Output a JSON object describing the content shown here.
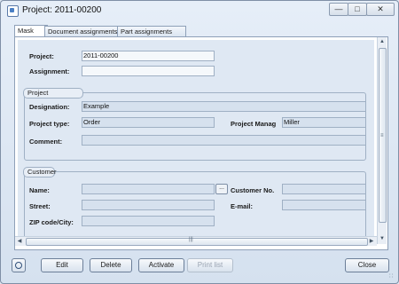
{
  "window": {
    "title": "Project: 2011-00200"
  },
  "tabs": [
    "Mask",
    "Document assignments",
    "Part assignments"
  ],
  "top": {
    "project_label": "Project:",
    "project_value": "2011-00200",
    "assignment_label": "Assignment:",
    "assignment_value": ""
  },
  "project_group": {
    "title": "Project",
    "designation_label": "Designation:",
    "designation_value": "Example",
    "type_label": "Project type:",
    "type_value": "Order",
    "manager_label": "Project Manag",
    "manager_value": "Miller",
    "comment_label": "Comment:",
    "comment_value": ""
  },
  "customer_group": {
    "title": "Customer",
    "name_label": "Name:",
    "name_value": "",
    "lookup_button": "...",
    "customer_no_label": "Customer No.",
    "customer_no_value": "",
    "street_label": "Street:",
    "street_value": "",
    "email_label": "E-mail:",
    "email_value": "",
    "zip_label": "ZIP code/City:",
    "zip_value": ""
  },
  "buttons": {
    "edit": "Edit",
    "delete": "Delete",
    "activate": "Activate",
    "print": "Print list",
    "close": "Close"
  },
  "scroll_grip": "|||",
  "colors": {
    "background": "#dfe8f3",
    "field": "#d6e1ee",
    "border": "#9fb0c4"
  }
}
